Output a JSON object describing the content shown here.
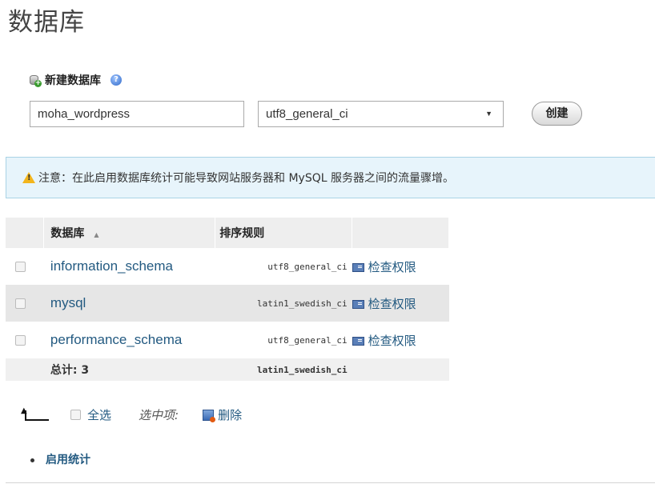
{
  "page_title": "数据库",
  "create": {
    "heading": "新建数据库",
    "db_name_value": "moha_wordpress",
    "collation_value": "utf8_general_ci",
    "create_label": "创建"
  },
  "notice": {
    "text": "注意：在此启用数据库统计可能导致网站服务器和 MySQL 服务器之间的流量骤增。"
  },
  "table": {
    "headers": {
      "database": "数据库",
      "collation": "排序规则"
    },
    "rows": [
      {
        "name": "information_schema",
        "collation": "utf8_general_ci",
        "privileges": "检查权限"
      },
      {
        "name": "mysql",
        "collation": "latin1_swedish_ci",
        "privileges": "检查权限"
      },
      {
        "name": "performance_schema",
        "collation": "utf8_general_ci",
        "privileges": "检查权限"
      }
    ],
    "footer": {
      "total_label": "总计: 3",
      "collation": "latin1_swedish_ci"
    }
  },
  "bulk": {
    "select_all": "全选",
    "with_selected": "选中项:",
    "delete": "删除"
  },
  "enable_stats": "启用统计"
}
